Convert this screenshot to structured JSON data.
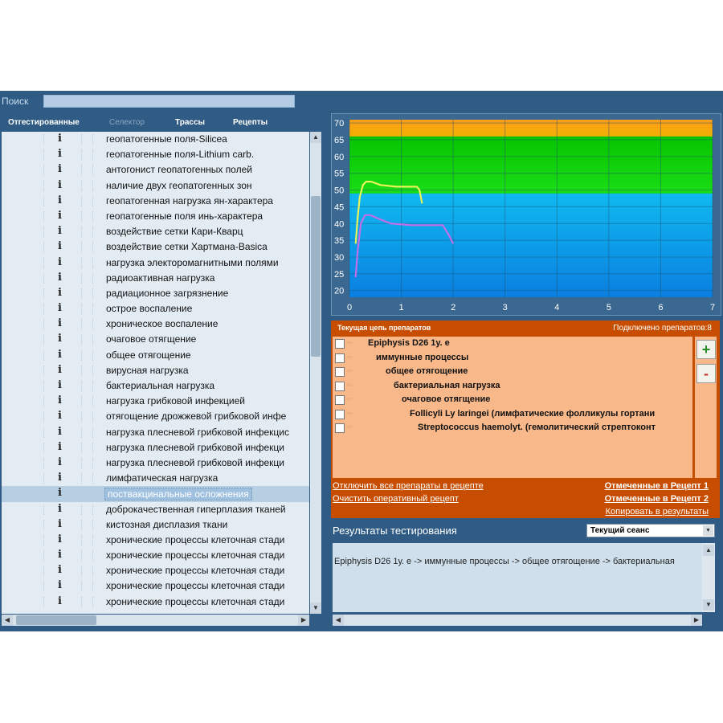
{
  "search": {
    "label": "Поиск",
    "value": ""
  },
  "tabs": [
    {
      "label": "Отгестированные",
      "enabled": true
    },
    {
      "label": "Селектор",
      "enabled": false
    },
    {
      "label": "Трассы",
      "enabled": true
    },
    {
      "label": "Рецепты",
      "enabled": true
    }
  ],
  "list": {
    "info_glyph": "i",
    "selected_index": 23,
    "items": [
      "геопатогенные поля-Silicea",
      "геопатогенные поля-Lithium carb.",
      "антогонист геопатогенных полей",
      "наличие двух геопатогенных зон",
      "геопатогенная нагрузка ян-характера",
      "геопатогенные поля инь-характера",
      "воздействие сетки Кари-Кварц",
      "воздействие сетки Хартмана-Basica",
      "нагрузка электоромагнитными полями",
      "радиоактивная нагрузка",
      "радиационное загрязнение",
      "острое воспаление",
      "хроническое воспаление",
      "очаговое отягщение",
      "общее отягощение",
      "вирусная нагрузка",
      "бактериальная нагрузка",
      "нагрузка грибковой инфекцией",
      "отягощение дрожжевой грибковой инфе",
      "нагрузка плесневой грибковой инфекцис",
      "нагрузка плесневой грибковой инфекци",
      "нагрузка плесневой грибковой инфекци",
      "лимфатическая нагрузка",
      "поствакцинальные осложнения",
      "доброкачественная гиперплазия тканей",
      "кистозная дисплазия ткани",
      "хронические процессы клеточная стади",
      "хронические процессы клеточная стади",
      "хронические процессы клеточная стади",
      "хронические процессы клеточная стади",
      "хронические процессы клеточная стади"
    ]
  },
  "chart_data": {
    "type": "line",
    "xlim": [
      0,
      7
    ],
    "ylim": [
      18,
      71
    ],
    "x_ticks": [
      0,
      1,
      2,
      3,
      4,
      5,
      6,
      7
    ],
    "y_ticks": [
      20,
      25,
      30,
      35,
      40,
      45,
      50,
      55,
      60,
      65,
      70
    ],
    "grid": true,
    "bands": [
      {
        "from": 18,
        "to": 49,
        "color_top": "#0fb9f0",
        "color_bottom": "#0a7fe0"
      },
      {
        "from": 49,
        "to": 66,
        "color_top": "#07c400",
        "color_bottom": "#19dd16"
      },
      {
        "from": 66,
        "to": 71,
        "color_top": "#ff9d1a",
        "color_bottom": "#f0b000"
      }
    ],
    "series": [
      {
        "color": "#eaf35a",
        "x": [
          0.12,
          0.16,
          0.2,
          0.26,
          0.32,
          0.42,
          0.6,
          0.9,
          1.1,
          1.3,
          1.35,
          1.4
        ],
        "y": [
          34,
          42,
          48,
          51.5,
          52.5,
          52.5,
          51.5,
          51,
          51,
          51,
          50,
          46
        ]
      },
      {
        "color": "#c06fe8",
        "x": [
          0.12,
          0.16,
          0.22,
          0.3,
          0.4,
          0.55,
          0.8,
          1.2,
          1.6,
          1.8,
          1.9,
          2.0
        ],
        "y": [
          24,
          32,
          40,
          42.5,
          42.5,
          41.5,
          40,
          39.5,
          39.5,
          39.5,
          37,
          34
        ]
      }
    ]
  },
  "chain": {
    "title": "Текущая цепь препаратов",
    "connected": "Подключено препаратов:8",
    "items": [
      {
        "text": "Epiphysis D26 1у. е",
        "indent": 0
      },
      {
        "text": "иммунные процессы",
        "indent": 1
      },
      {
        "text": "общее отягощение",
        "indent": 2
      },
      {
        "text": "бактериальная нагрузка",
        "indent": 3
      },
      {
        "text": "очаговое отягщение",
        "indent": 4
      },
      {
        "text": "Follicyli Ly laringei (лимфатические фолликулы гортани",
        "indent": 5
      },
      {
        "text": "Streptococcus haemolyt. (гемолитический стрептоконт",
        "indent": 6
      }
    ],
    "plus_label": "+",
    "minus_label": "-",
    "link_disable_all": "Отключить все препараты в рецепте",
    "link_clear": "Очистить оперативный рецепт",
    "link_recipe1": "Отмеченные в Рецепт 1",
    "link_recipe2": "Отмеченные в Рецепт 2",
    "link_copy": "Копировать в результаты"
  },
  "results": {
    "title": "Результаты тестирования",
    "session": "Текущий сеанс",
    "text": "Epiphysis D26 1у. е -> иммунные процессы -> общее отягощение -> бактериальная"
  }
}
